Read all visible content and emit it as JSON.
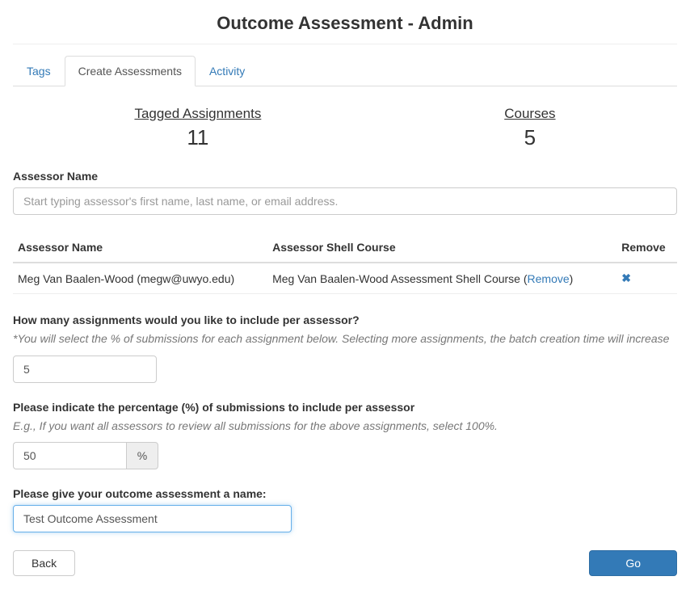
{
  "page": {
    "title": "Outcome Assessment - Admin"
  },
  "tabs": {
    "items": [
      {
        "label": "Tags",
        "active": false
      },
      {
        "label": "Create Assessments",
        "active": true
      },
      {
        "label": "Activity",
        "active": false
      }
    ]
  },
  "stats": {
    "tagged_assignments": {
      "label": "Tagged Assignments",
      "value": "11"
    },
    "courses": {
      "label": "Courses",
      "value": "5"
    }
  },
  "assessor": {
    "label": "Assessor Name",
    "placeholder": "Start typing assessor's first name, last name, or email address."
  },
  "table": {
    "headers": {
      "name": "Assessor Name",
      "shell": "Assessor Shell Course",
      "remove": "Remove"
    },
    "rows": [
      {
        "name": "Meg Van Baalen-Wood (megw@uwyo.edu)",
        "shell_prefix": "Meg Van Baalen-Wood Assessment Shell Course (",
        "shell_link": "Remove",
        "shell_suffix": ")"
      }
    ]
  },
  "assignments_count": {
    "label": "How many assignments would you like to include per assessor?",
    "hint": "*You will select the % of submissions for each assignment below. Selecting more assignments, the batch creation time will increase",
    "value": "5"
  },
  "percentage": {
    "label": "Please indicate the percentage (%) of submissions to include per assessor",
    "hint": "E.g., If you want all assessors to review all submissions for the above assignments, select 100%.",
    "value": "50",
    "addon": "%"
  },
  "assessment_name": {
    "label": "Please give your outcome assessment a name:",
    "value": "Test Outcome Assessment"
  },
  "buttons": {
    "back": "Back",
    "go": "Go"
  }
}
